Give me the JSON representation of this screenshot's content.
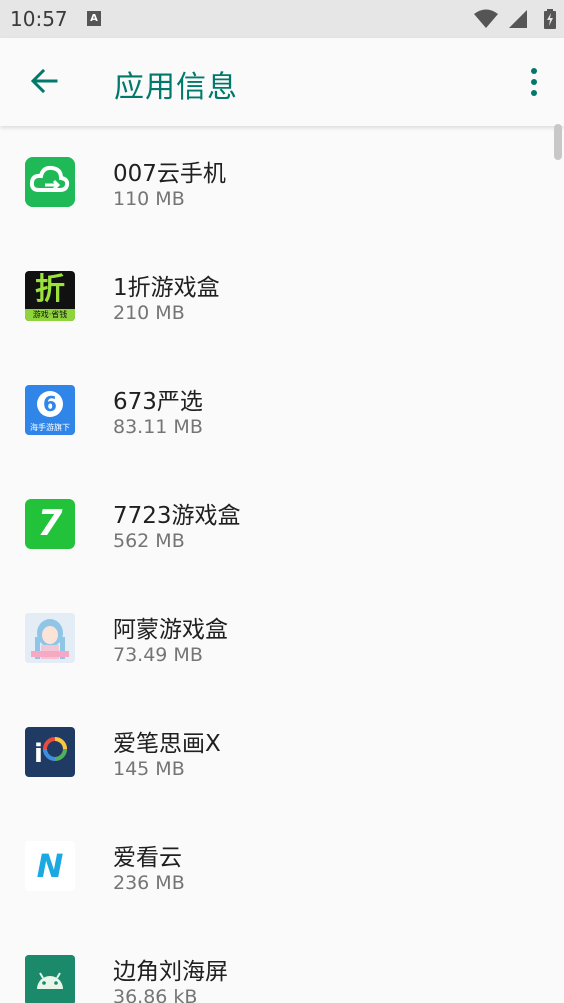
{
  "status": {
    "time": "10:57",
    "notification_badge": "A"
  },
  "header": {
    "title": "应用信息"
  },
  "apps": [
    {
      "name": "007云手机",
      "size": "110 MB"
    },
    {
      "name": "1折游戏盒",
      "size": "210 MB"
    },
    {
      "name": "673严选",
      "size": "83.11 MB"
    },
    {
      "name": "7723游戏盒",
      "size": "562 MB"
    },
    {
      "name": "阿蒙游戏盒",
      "size": "73.49 MB"
    },
    {
      "name": "爱笔思画X",
      "size": "145 MB"
    },
    {
      "name": "爱看云",
      "size": "236 MB"
    },
    {
      "name": "边角刘海屏",
      "size": "36.86 kB"
    }
  ],
  "icons": {
    "app0": {
      "name": "cloud-phone-icon"
    },
    "app1": {
      "name": "zhe-game-box-icon",
      "glyph": "折",
      "caption": "游戏·省钱"
    },
    "app2": {
      "name": "six-seven-three-icon",
      "glyph": "6",
      "caption": "海手游旗下"
    },
    "app3": {
      "name": "seven-game-icon",
      "glyph": "7"
    },
    "app4": {
      "name": "anime-girl-icon"
    },
    "app5": {
      "name": "ibis-paint-icon",
      "glyph": "i"
    },
    "app6": {
      "name": "ikan-cloud-icon",
      "glyph": "N"
    },
    "app7": {
      "name": "android-icon"
    }
  },
  "colors": {
    "accent": "#00796b",
    "status_bar": "#e6e6e6",
    "background": "#fafafa"
  }
}
